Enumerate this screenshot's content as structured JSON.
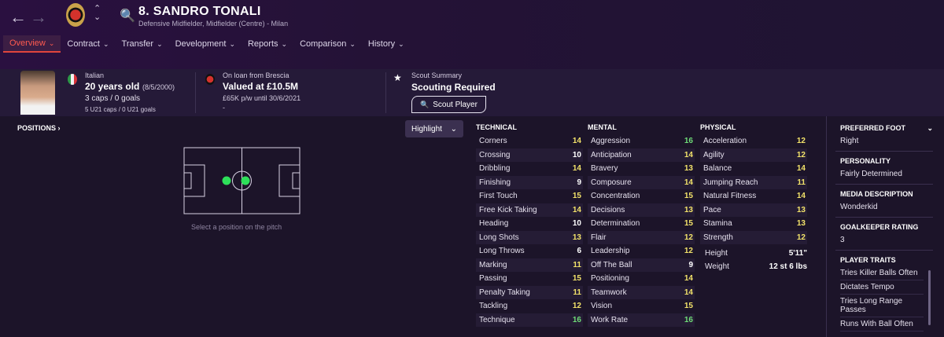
{
  "header": {
    "back_icon": "arrow-left-icon",
    "forward_icon": "arrow-right-icon",
    "player_name": "8. SANDRO TONALI",
    "player_subtitle": "Defensive Midfielder, Midfielder (Centre) - Milan"
  },
  "tabs": [
    {
      "label": "Overview",
      "active": true
    },
    {
      "label": "Contract"
    },
    {
      "label": "Transfer"
    },
    {
      "label": "Development"
    },
    {
      "label": "Reports"
    },
    {
      "label": "Comparison"
    },
    {
      "label": "History"
    }
  ],
  "info": {
    "nationality": "Italian",
    "age": "20 years old",
    "dob": "(8/5/2000)",
    "caps": "3 caps / 0 goals",
    "u21_caps": "5 U21 caps / 0 U21 goals",
    "loan_from": "On loan from Brescia",
    "value": "Valued at £10.5M",
    "wage": "£65K p/w until 30/6/2021",
    "wage_extra": "-",
    "scout_title": "Scout Summary",
    "scout_status": "Scouting Required",
    "scout_button": "Scout Player"
  },
  "positions": {
    "label": "POSITIONS",
    "highlight": "Highlight",
    "caption": "Select a position on the pitch"
  },
  "technical": {
    "title": "TECHNICAL",
    "rows": [
      {
        "name": "Corners",
        "value": "14",
        "color": "yellow"
      },
      {
        "name": "Crossing",
        "value": "10",
        "color": "white"
      },
      {
        "name": "Dribbling",
        "value": "14",
        "color": "yellow"
      },
      {
        "name": "Finishing",
        "value": "9",
        "color": "white"
      },
      {
        "name": "First Touch",
        "value": "15",
        "color": "yellow"
      },
      {
        "name": "Free Kick Taking",
        "value": "14",
        "color": "yellow"
      },
      {
        "name": "Heading",
        "value": "10",
        "color": "white"
      },
      {
        "name": "Long Shots",
        "value": "13",
        "color": "yellow"
      },
      {
        "name": "Long Throws",
        "value": "6",
        "color": "white"
      },
      {
        "name": "Marking",
        "value": "11",
        "color": "yellow"
      },
      {
        "name": "Passing",
        "value": "15",
        "color": "yellow"
      },
      {
        "name": "Penalty Taking",
        "value": "11",
        "color": "yellow"
      },
      {
        "name": "Tackling",
        "value": "12",
        "color": "yellow"
      },
      {
        "name": "Technique",
        "value": "16",
        "color": "green"
      }
    ]
  },
  "mental": {
    "title": "MENTAL",
    "rows": [
      {
        "name": "Aggression",
        "value": "16",
        "color": "green"
      },
      {
        "name": "Anticipation",
        "value": "14",
        "color": "yellow"
      },
      {
        "name": "Bravery",
        "value": "13",
        "color": "yellow"
      },
      {
        "name": "Composure",
        "value": "14",
        "color": "yellow"
      },
      {
        "name": "Concentration",
        "value": "15",
        "color": "yellow"
      },
      {
        "name": "Decisions",
        "value": "13",
        "color": "yellow"
      },
      {
        "name": "Determination",
        "value": "15",
        "color": "yellow"
      },
      {
        "name": "Flair",
        "value": "12",
        "color": "yellow"
      },
      {
        "name": "Leadership",
        "value": "12",
        "color": "yellow"
      },
      {
        "name": "Off The Ball",
        "value": "9",
        "color": "white"
      },
      {
        "name": "Positioning",
        "value": "14",
        "color": "yellow"
      },
      {
        "name": "Teamwork",
        "value": "14",
        "color": "yellow"
      },
      {
        "name": "Vision",
        "value": "15",
        "color": "yellow"
      },
      {
        "name": "Work Rate",
        "value": "16",
        "color": "green"
      }
    ]
  },
  "physical": {
    "title": "PHYSICAL",
    "rows": [
      {
        "name": "Acceleration",
        "value": "12",
        "color": "yellow"
      },
      {
        "name": "Agility",
        "value": "12",
        "color": "yellow"
      },
      {
        "name": "Balance",
        "value": "14",
        "color": "yellow"
      },
      {
        "name": "Jumping Reach",
        "value": "11",
        "color": "yellow"
      },
      {
        "name": "Natural Fitness",
        "value": "14",
        "color": "yellow"
      },
      {
        "name": "Pace",
        "value": "13",
        "color": "yellow"
      },
      {
        "name": "Stamina",
        "value": "13",
        "color": "yellow"
      },
      {
        "name": "Strength",
        "value": "12",
        "color": "yellow"
      }
    ],
    "height_label": "Height",
    "height_value": "5'11\"",
    "weight_label": "Weight",
    "weight_value": "12 st 6 lbs"
  },
  "side": {
    "foot_label": "PREFERRED FOOT",
    "foot_value": "Right",
    "personality_label": "PERSONALITY",
    "personality_value": "Fairly Determined",
    "media_label": "MEDIA DESCRIPTION",
    "media_value": "Wonderkid",
    "gk_label": "GOALKEEPER RATING",
    "gk_value": "3",
    "traits_label": "PLAYER TRAITS",
    "traits": [
      "Tries Killer Balls Often",
      "Dictates Tempo",
      "Tries Long Range Passes",
      "Runs With Ball Often"
    ]
  },
  "colors": {
    "white": "#ffffff",
    "yellow": "#f2e26a",
    "green": "#6fdc78",
    "accent": "#e0453d"
  }
}
